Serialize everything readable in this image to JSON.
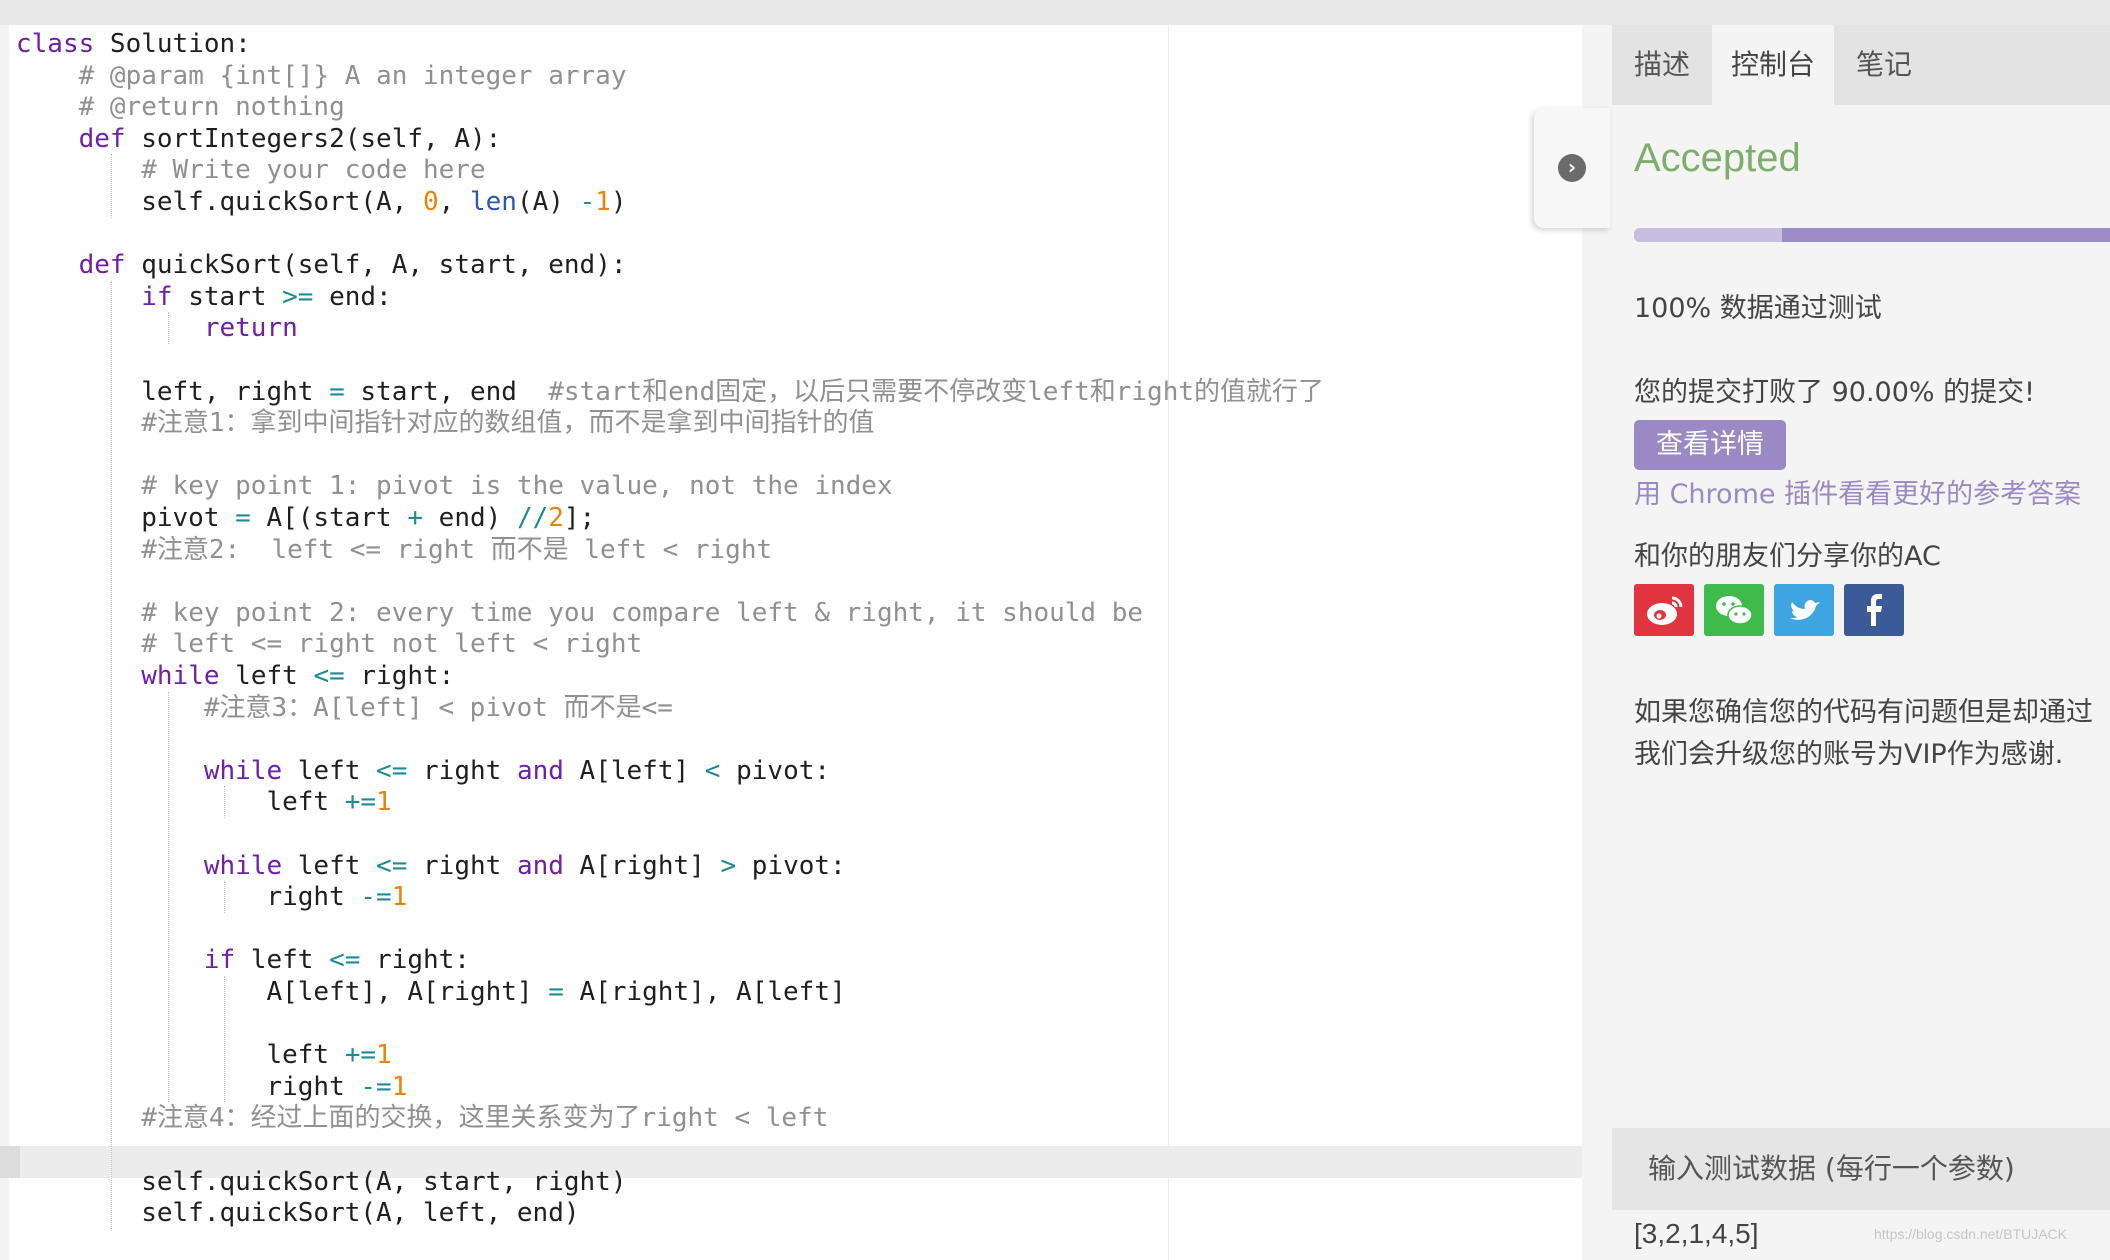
{
  "code_lines": [
    [
      [
        "kw",
        "class"
      ],
      [
        "",
        "Solution:"
      ]
    ],
    [
      [
        "",
        "    "
      ],
      [
        "cm",
        "# @param {int[]} A an integer array"
      ]
    ],
    [
      [
        "",
        "    "
      ],
      [
        "cm",
        "# @return nothing"
      ]
    ],
    [
      [
        "",
        "    "
      ],
      [
        "kw",
        "def"
      ],
      [
        "",
        "sortIntegers2(self, A):"
      ]
    ],
    [
      [
        "",
        "        "
      ],
      [
        "cm",
        "# Write your code here"
      ]
    ],
    [
      [
        "",
        "        self.quickSort(A, "
      ],
      [
        "num",
        "0"
      ],
      [
        "",
        ", "
      ],
      [
        "bi",
        "len"
      ],
      [
        "",
        "(A) "
      ],
      [
        "op",
        "-"
      ],
      [
        "",
        ""
      ],
      [
        "num",
        "1"
      ],
      [
        "",
        ")"
      ]
    ],
    [],
    [
      [
        "",
        "    "
      ],
      [
        "kw",
        "def"
      ],
      [
        "",
        "quickSort(self, A, start, end):"
      ]
    ],
    [
      [
        "",
        "        "
      ],
      [
        "kw",
        "if"
      ],
      [
        "",
        "start "
      ],
      [
        "op",
        ">="
      ],
      [
        "",
        "end:"
      ]
    ],
    [
      [
        "",
        "            "
      ],
      [
        "kw",
        "return"
      ]
    ],
    [],
    [
      [
        "",
        "        left, right "
      ],
      [
        "op",
        "="
      ],
      [
        "",
        "start, end  "
      ],
      [
        "cm",
        "#start和end固定，以后只需要不停改变left和right的值就行了"
      ]
    ],
    [
      [
        "",
        "        "
      ],
      [
        "cm",
        "#注意1：拿到中间指针对应的数组值，而不是拿到中间指针的值"
      ]
    ],
    [],
    [
      [
        "",
        "        "
      ],
      [
        "cm",
        "# key point 1: pivot is the value, not the index"
      ]
    ],
    [
      [
        "",
        "        pivot "
      ],
      [
        "op",
        "="
      ],
      [
        "",
        "A[(start "
      ],
      [
        "op",
        "+"
      ],
      [
        "",
        "end) "
      ],
      [
        "op",
        "//"
      ],
      [
        "",
        ""
      ],
      [
        "num",
        "2"
      ],
      [
        "",
        "];"
      ]
    ],
    [
      [
        "",
        "        "
      ],
      [
        "cm",
        "#注意2:  left <= right 而不是 left < right"
      ]
    ],
    [],
    [
      [
        "",
        "        "
      ],
      [
        "cm",
        "# key point 2: every time you compare left & right, it should be"
      ]
    ],
    [
      [
        "",
        "        "
      ],
      [
        "cm",
        "# left <= right not left < right"
      ]
    ],
    [
      [
        "",
        "        "
      ],
      [
        "kw",
        "while"
      ],
      [
        "",
        "left "
      ],
      [
        "op",
        "<="
      ],
      [
        "",
        "right:"
      ]
    ],
    [
      [
        "",
        "            "
      ],
      [
        "cm",
        "#注意3：A[left] < pivot 而不是<="
      ]
    ],
    [],
    [
      [
        "",
        "            "
      ],
      [
        "kw",
        "while"
      ],
      [
        "",
        "left "
      ],
      [
        "op",
        "<="
      ],
      [
        "",
        "right "
      ],
      [
        "kw",
        "and"
      ],
      [
        "",
        "A[left] "
      ],
      [
        "op",
        "<"
      ],
      [
        "",
        "pivot:"
      ]
    ],
    [
      [
        "",
        "                left "
      ],
      [
        "op",
        "+="
      ],
      [
        "",
        ""
      ],
      [
        "num",
        "1"
      ]
    ],
    [],
    [
      [
        "",
        "            "
      ],
      [
        "kw",
        "while"
      ],
      [
        "",
        "left "
      ],
      [
        "op",
        "<="
      ],
      [
        "",
        "right "
      ],
      [
        "kw",
        "and"
      ],
      [
        "",
        "A[right] "
      ],
      [
        "op",
        ">"
      ],
      [
        "",
        "pivot:"
      ]
    ],
    [
      [
        "",
        "                right "
      ],
      [
        "op",
        "-="
      ],
      [
        "",
        ""
      ],
      [
        "num",
        "1"
      ]
    ],
    [],
    [
      [
        "",
        "            "
      ],
      [
        "kw",
        "if"
      ],
      [
        "",
        "left "
      ],
      [
        "op",
        "<="
      ],
      [
        "",
        "right:"
      ]
    ],
    [
      [
        "",
        "                A[left], A[right] "
      ],
      [
        "op",
        "="
      ],
      [
        "",
        "A[right], A[left]"
      ]
    ],
    [],
    [
      [
        "",
        "                left "
      ],
      [
        "op",
        "+="
      ],
      [
        "",
        ""
      ],
      [
        "num",
        "1"
      ]
    ],
    [
      [
        "",
        "                right "
      ],
      [
        "op",
        "-="
      ],
      [
        "",
        ""
      ],
      [
        "num",
        "1"
      ]
    ],
    [
      [
        "",
        "        "
      ],
      [
        "cm",
        "#注意4：经过上面的交换，这里关系变为了right < left"
      ]
    ],
    [],
    [
      [
        "",
        "        self.quickSort(A, start, right)"
      ]
    ],
    [
      [
        "",
        "        self.quickSort(A, left, end)"
      ]
    ]
  ],
  "colors": {
    "keyword": "#6f1fa8",
    "comment": "#909090",
    "number": "#e8830c",
    "operator": "#1d8a95",
    "builtin": "#2f55b0",
    "accepted": "#7fae6c",
    "accent": "#9a89c4"
  },
  "tabs": [
    {
      "label": "描述",
      "active": false
    },
    {
      "label": "控制台",
      "active": true
    },
    {
      "label": "笔记",
      "active": false
    }
  ],
  "panel": {
    "collapse_icon": "chevron-right-icon",
    "status": "Accepted",
    "progress_fraction": 0.31,
    "tests_passed": "100% 数据通过测试",
    "beat_text": "您的提交打败了 90.00% 的提交!",
    "detail_button": "查看详情",
    "chrome_link": "用 Chrome 插件看看更好的参考答案",
    "share_label": "和你的朋友们分享你的AC",
    "share_buttons": [
      {
        "icon": "weibo-icon",
        "color": "#e0343f"
      },
      {
        "icon": "wechat-icon",
        "color": "#3fbb4c"
      },
      {
        "icon": "twitter-icon",
        "color": "#3fa4e2"
      },
      {
        "icon": "facebook-icon",
        "color": "#3b5a98"
      }
    ],
    "vip_line1": "如果您确信您的代码有问题但是却通过",
    "vip_line2": "我们会升级您的账号为VIP作为感谢.",
    "input_label": "输入测试数据 (每行一个参数)",
    "input_value": "[3,2,1,4,5]"
  },
  "watermark": "https://blog.csdn.net/BTUJACK"
}
